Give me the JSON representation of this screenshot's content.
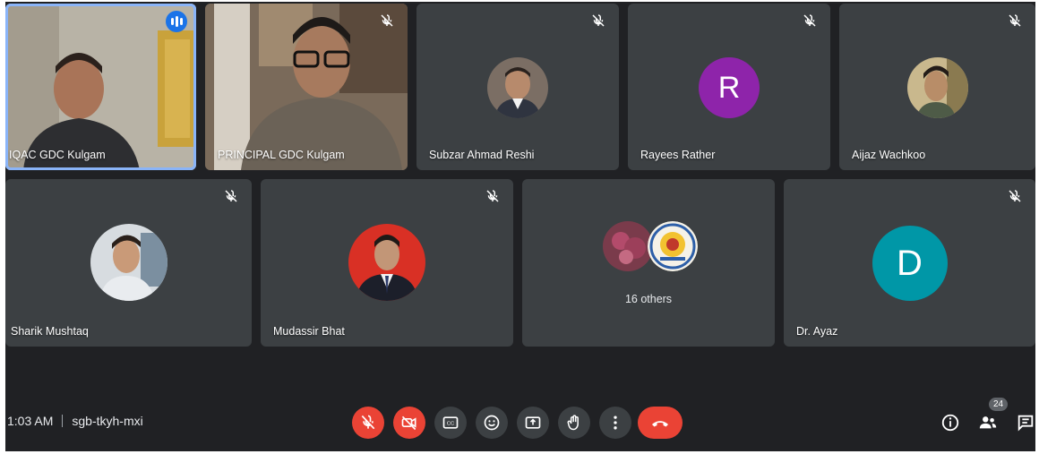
{
  "participants": {
    "iqac": {
      "name": "IQAC GDC Kulgam"
    },
    "principal": {
      "name": "PRINCIPAL GDC Kulgam"
    },
    "subzar": {
      "name": "Subzar Ahmad Reshi"
    },
    "rayees": {
      "name": "Rayees Rather",
      "initial": "R",
      "color": "#8e24aa"
    },
    "aijaz": {
      "name": "Aijaz Wachkoo"
    },
    "sharik": {
      "name": "Sharik Mushtaq"
    },
    "mudassir": {
      "name": "Mudassir Bhat"
    },
    "others": {
      "label": "16 others"
    },
    "ayaz": {
      "name": "Dr. Ayaz",
      "initial": "D",
      "color": "#0097a7"
    }
  },
  "meeting": {
    "time": "1:03 AM",
    "code": "sgb-tkyh-mxi",
    "participant_count": "24"
  },
  "controls": [
    {
      "name": "mic-toggle-button",
      "icon": "mic-off-icon"
    },
    {
      "name": "camera-toggle-button",
      "icon": "camera-off-icon"
    },
    {
      "name": "captions-button",
      "icon": "captions-icon"
    },
    {
      "name": "emoji-button",
      "icon": "emoji-icon"
    },
    {
      "name": "present-button",
      "icon": "present-icon"
    },
    {
      "name": "raise-hand-button",
      "icon": "hand-icon"
    },
    {
      "name": "more-options-button",
      "icon": "more-vert-icon"
    },
    {
      "name": "leave-call-button",
      "icon": "end-call-icon"
    }
  ]
}
